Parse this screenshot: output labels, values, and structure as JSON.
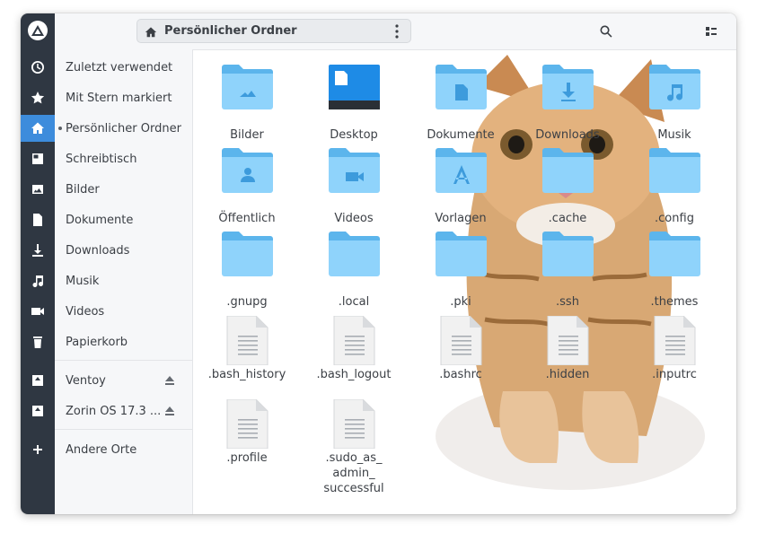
{
  "window": {
    "path_label": "Persönlicher Ordner"
  },
  "sidebar": {
    "items": [
      {
        "label": "Zuletzt verwendet",
        "icon": "clock-icon"
      },
      {
        "label": "Mit Stern markiert",
        "icon": "star-icon"
      },
      {
        "label": "Persönlicher Ordner",
        "icon": "home-icon",
        "active": true
      },
      {
        "label": "Schreibtisch",
        "icon": "desktop-icon"
      },
      {
        "label": "Bilder",
        "icon": "image-icon"
      },
      {
        "label": "Dokumente",
        "icon": "document-icon"
      },
      {
        "label": "Downloads",
        "icon": "download-icon"
      },
      {
        "label": "Musik",
        "icon": "music-icon"
      },
      {
        "label": "Videos",
        "icon": "video-icon"
      },
      {
        "label": "Papierkorb",
        "icon": "trash-icon"
      }
    ],
    "drives": [
      {
        "label": "Ventoy",
        "icon": "drive-icon"
      },
      {
        "label": "Zorin OS 17.3 ...",
        "icon": "drive-icon"
      }
    ],
    "other": {
      "label": "Andere Orte",
      "icon": "plus-icon"
    }
  },
  "files": [
    {
      "name": "Bilder",
      "type": "folder",
      "emblem": "image"
    },
    {
      "name": "Desktop",
      "type": "desktop"
    },
    {
      "name": "Dokumente",
      "type": "folder",
      "emblem": "document"
    },
    {
      "name": "Downloads",
      "type": "folder",
      "emblem": "download"
    },
    {
      "name": "Musik",
      "type": "folder",
      "emblem": "music"
    },
    {
      "name": "Öffentlich",
      "type": "folder",
      "emblem": "person"
    },
    {
      "name": "Videos",
      "type": "folder",
      "emblem": "video"
    },
    {
      "name": "Vorlagen",
      "type": "folder",
      "emblem": "template"
    },
    {
      "name": ".cache",
      "type": "folder"
    },
    {
      "name": ".config",
      "type": "folder"
    },
    {
      "name": ".gnupg",
      "type": "folder"
    },
    {
      "name": ".local",
      "type": "folder"
    },
    {
      "name": ".pki",
      "type": "folder"
    },
    {
      "name": ".ssh",
      "type": "folder"
    },
    {
      "name": ".themes",
      "type": "folder"
    },
    {
      "name": ".bash_history",
      "type": "text"
    },
    {
      "name": ".bash_logout",
      "type": "text"
    },
    {
      "name": ".bashrc",
      "type": "text"
    },
    {
      "name": ".hidden",
      "type": "text"
    },
    {
      "name": ".inputrc",
      "type": "text"
    },
    {
      "name": ".profile",
      "type": "text"
    },
    {
      "name": ".sudo_as_admin_successful",
      "type": "text",
      "display": ".sudo_as_\nadmin_\nsuccessful"
    }
  ],
  "colors": {
    "accent": "#3d8cdc",
    "folder": "#8fd3fb",
    "folder_tab": "#5cb5ec",
    "rail": "#2f3742"
  }
}
